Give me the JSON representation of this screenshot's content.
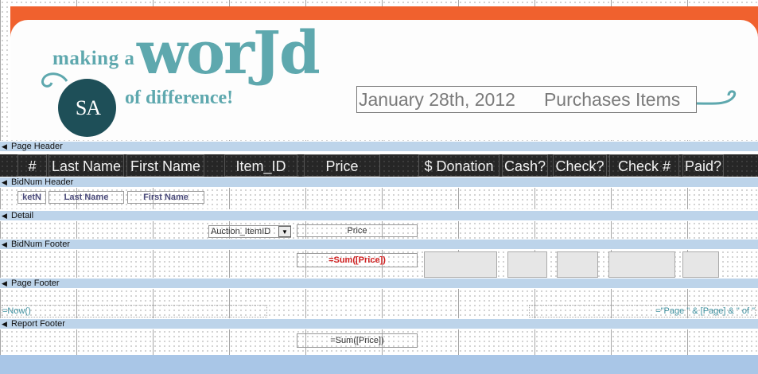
{
  "banner": {
    "logo_making": "making a",
    "logo_world": "worJd",
    "logo_difference": "of difference!",
    "logo_emblem": "S A",
    "title_date": "January 28th, 2012",
    "title_text": "Purchases Items"
  },
  "sections": {
    "page_header": "Page Header",
    "bidnum_header": "BidNum Header",
    "detail": "Detail",
    "bidnum_footer": "BidNum Footer",
    "page_footer": "Page Footer",
    "report_footer": "Report Footer"
  },
  "columns": [
    "#",
    "Last Name",
    "First Name",
    "Item_ID",
    "Price",
    "$ Donation",
    "Cash?",
    "Check?",
    "Check #",
    "Paid?"
  ],
  "bidnum_header_fields": [
    "ketN",
    "Last Name",
    "First Name"
  ],
  "detail_fields": {
    "item_combo": "Auction_ItemID",
    "price": "Price"
  },
  "bidnum_footer_fields": {
    "sum": "=Sum([Price])"
  },
  "page_footer_fields": {
    "now": "=Now()",
    "page": "=\"Page \" & [Page] & \" of \""
  },
  "report_footer_fields": {
    "sum": "=Sum([Price])"
  },
  "colors": {
    "banner_orange": "#f0612e",
    "section_bar": "#bdd4ea",
    "logo_teal": "#5ea8ae",
    "header_row": "#262626"
  }
}
